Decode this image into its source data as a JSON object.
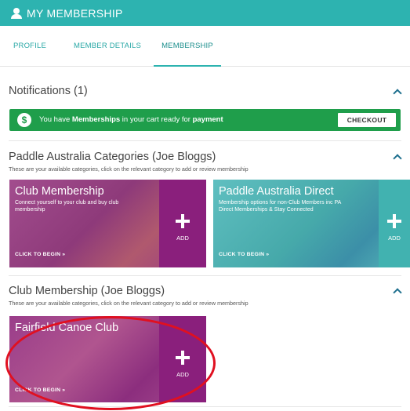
{
  "header": {
    "title": "MY MEMBERSHIP"
  },
  "tabs": [
    {
      "label": "PROFILE"
    },
    {
      "label": "MEMBER DETAILS"
    },
    {
      "label": "MEMBERSHIP"
    }
  ],
  "notifications": {
    "title": "Notifications (1)",
    "message_prefix": "You have ",
    "message_bold1": "Memberships",
    "message_mid": " in your cart ready for ",
    "message_bold2": "payment",
    "checkout_label": "CHECKOUT"
  },
  "categories": {
    "title": "Paddle Australia Categories (Joe Bloggs)",
    "subtitle": "These are your available categories, click on the relevant category to add or review membership",
    "cards": [
      {
        "title": "Club Membership",
        "desc": "Connect yourself to your club and buy club membership",
        "add_label": "ADD",
        "cta": "CLICK TO BEGIN »"
      },
      {
        "title": "Paddle Australia Direct",
        "desc": "Membership options for non-Club Members inc PA Direct Memberships & Stay Connected",
        "add_label": "ADD",
        "cta": "CLICK TO BEGIN »"
      }
    ]
  },
  "club_membership": {
    "title": "Club Membership (Joe Bloggs)",
    "subtitle": "These are your available categories, click on the relevant category to add or review membership",
    "cards": [
      {
        "title": "Fairfield Canoe Club",
        "add_label": "ADD",
        "cta": "CLICK TO BEGIN »"
      }
    ]
  },
  "colors": {
    "header_teal": "#2db3b0",
    "notif_green": "#1f9e4b",
    "club_purple": "#8a1f7c",
    "pad_teal": "#41b2b0",
    "annotation_red": "#e01020"
  }
}
